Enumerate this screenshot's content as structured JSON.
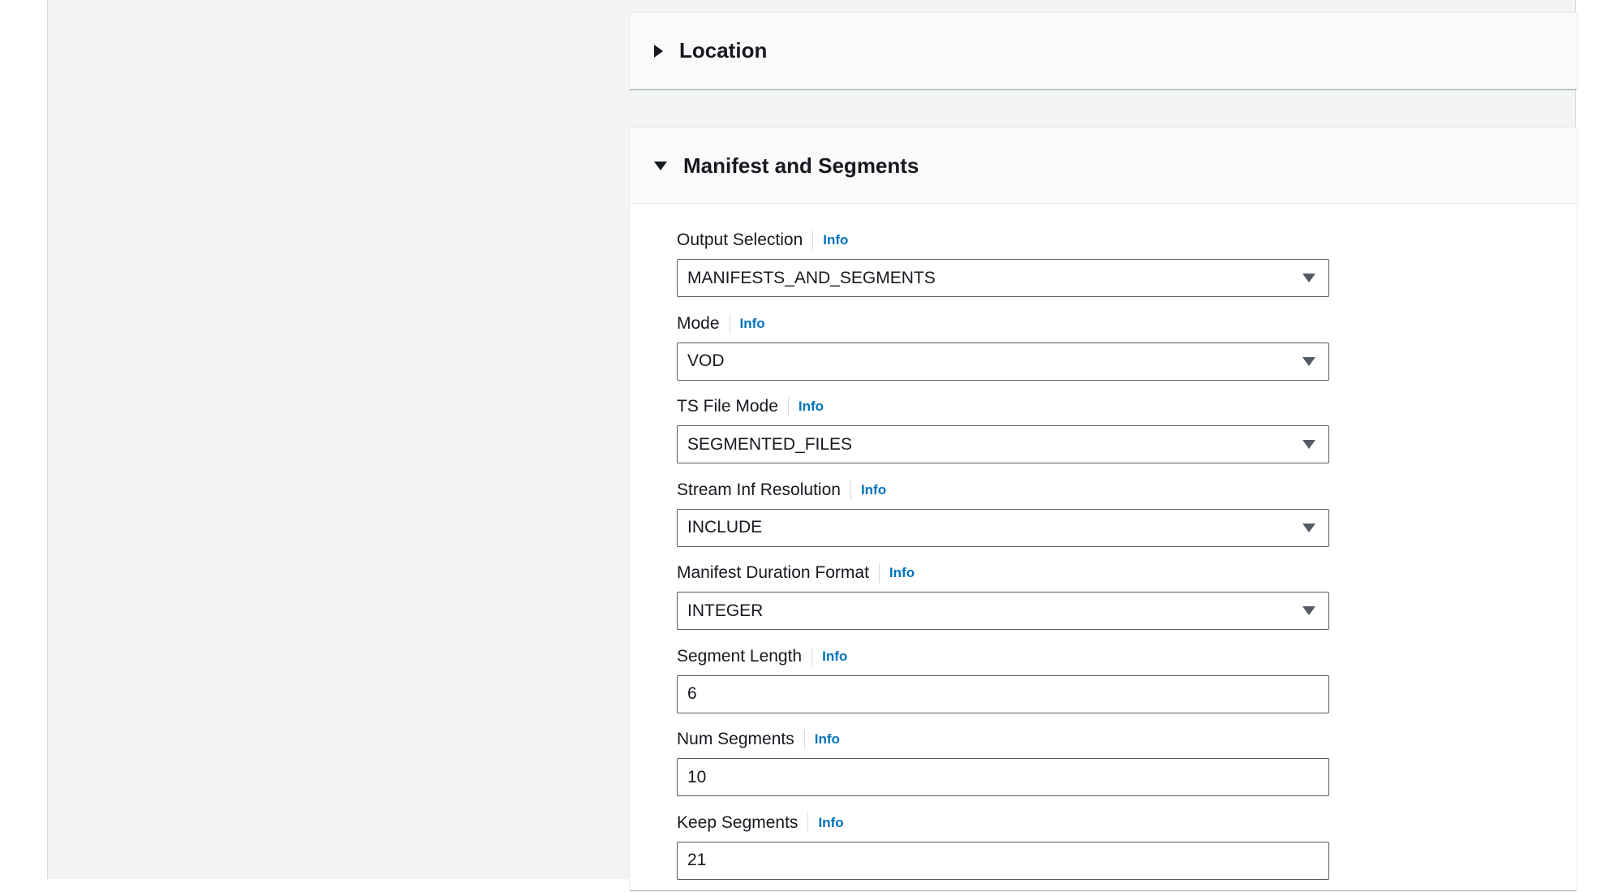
{
  "sections": {
    "location": {
      "title": "Location",
      "expanded": false
    },
    "manifest": {
      "title": "Manifest and Segments",
      "expanded": true
    }
  },
  "info_label": "Info",
  "fields": {
    "output_selection": {
      "label": "Output Selection",
      "value": "MANIFESTS_AND_SEGMENTS",
      "type": "select"
    },
    "mode": {
      "label": "Mode",
      "value": "VOD",
      "type": "select"
    },
    "ts_file_mode": {
      "label": "TS File Mode",
      "value": "SEGMENTED_FILES",
      "type": "select"
    },
    "stream_inf_resolution": {
      "label": "Stream Inf Resolution",
      "value": "INCLUDE",
      "type": "select"
    },
    "manifest_duration_format": {
      "label": "Manifest Duration Format",
      "value": "INTEGER",
      "type": "select"
    },
    "segment_length": {
      "label": "Segment Length",
      "value": "6",
      "type": "input"
    },
    "num_segments": {
      "label": "Num Segments",
      "value": "10",
      "type": "input"
    },
    "keep_segments": {
      "label": "Keep Segments",
      "value": "21",
      "type": "input"
    }
  },
  "colors": {
    "link": "#0073bb",
    "background": "#f2f3f3",
    "text": "#16191f"
  }
}
